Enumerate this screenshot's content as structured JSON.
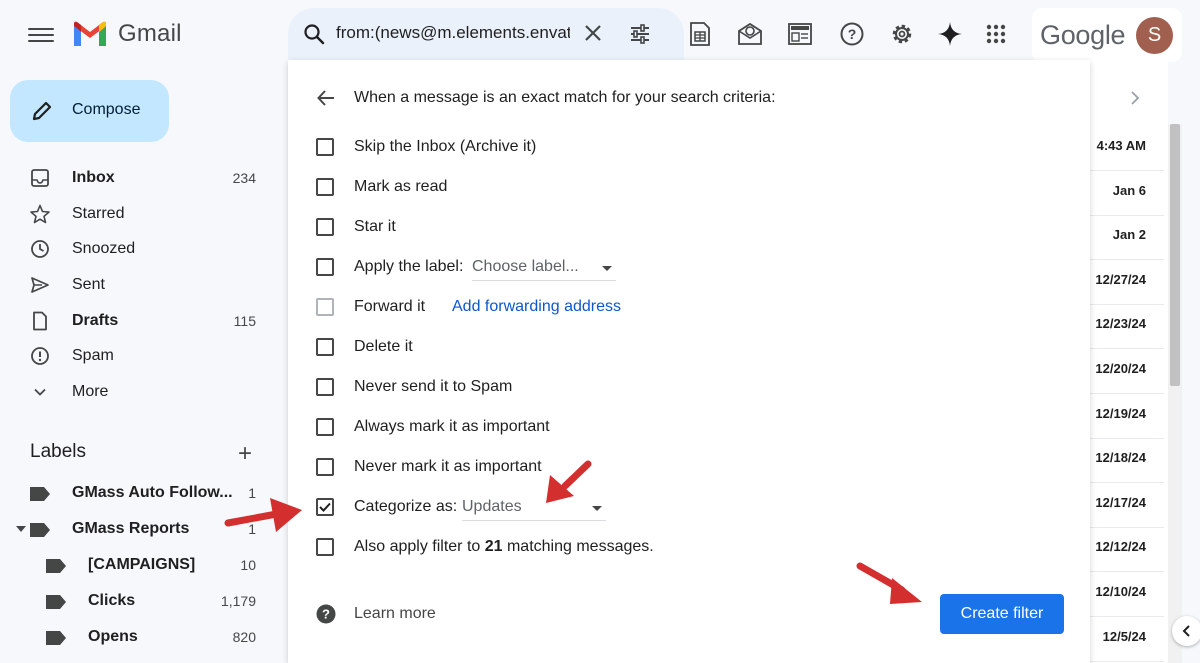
{
  "app": {
    "logo_text": "Gmail",
    "google_word": "Google",
    "avatar_initial": "S"
  },
  "search": {
    "query": "from:(news@m.elements.envato.com)"
  },
  "compose": {
    "label": "Compose"
  },
  "nav": [
    {
      "label": "Inbox",
      "count": "234",
      "bold": true,
      "icon": "inbox-icon"
    },
    {
      "label": "Starred",
      "count": "",
      "bold": false,
      "icon": "star-icon"
    },
    {
      "label": "Snoozed",
      "count": "",
      "bold": false,
      "icon": "clock-icon"
    },
    {
      "label": "Sent",
      "count": "",
      "bold": false,
      "icon": "send-icon"
    },
    {
      "label": "Drafts",
      "count": "115",
      "bold": true,
      "icon": "draft-icon"
    },
    {
      "label": "Spam",
      "count": "",
      "bold": false,
      "icon": "spam-icon"
    },
    {
      "label": "More",
      "count": "",
      "bold": false,
      "icon": "chevron-down-icon"
    }
  ],
  "labels": {
    "heading": "Labels",
    "items": [
      {
        "name": "GMass Auto Follow...",
        "count": "1"
      },
      {
        "name": "GMass Reports",
        "count": "1"
      },
      {
        "name": "[CAMPAIGNS]",
        "count": "10"
      },
      {
        "name": "Clicks",
        "count": "1,179"
      },
      {
        "name": "Opens",
        "count": "820"
      }
    ]
  },
  "dates": [
    "4:43 AM",
    "Jan 6",
    "Jan 2",
    "12/27/24",
    "12/23/24",
    "12/20/24",
    "12/19/24",
    "12/18/24",
    "12/17/24",
    "12/12/24",
    "12/10/24",
    "12/5/24"
  ],
  "filter": {
    "title": "When a message is an exact match for your search criteria:",
    "options": {
      "skip_inbox": "Skip the Inbox (Archive it)",
      "mark_read": "Mark as read",
      "star": "Star it",
      "apply_label": "Apply the label:",
      "choose_label": "Choose label...",
      "forward": "Forward it",
      "add_forwarding": "Add forwarding address",
      "delete": "Delete it",
      "never_spam": "Never send it to Spam",
      "always_important": "Always mark it as important",
      "never_important": "Never mark it as important",
      "categorize": "Categorize as:",
      "category_value": "Updates",
      "also_apply_pre": "Also apply filter to ",
      "also_apply_count": "21",
      "also_apply_post": " matching messages."
    },
    "learn_more": "Learn more",
    "create_button": "Create filter"
  },
  "colors": {
    "annotation_arrow": "#d32f2f",
    "primary_button": "#1a73e8",
    "compose_bg": "#c2e7ff",
    "link": "#0b57d0"
  }
}
